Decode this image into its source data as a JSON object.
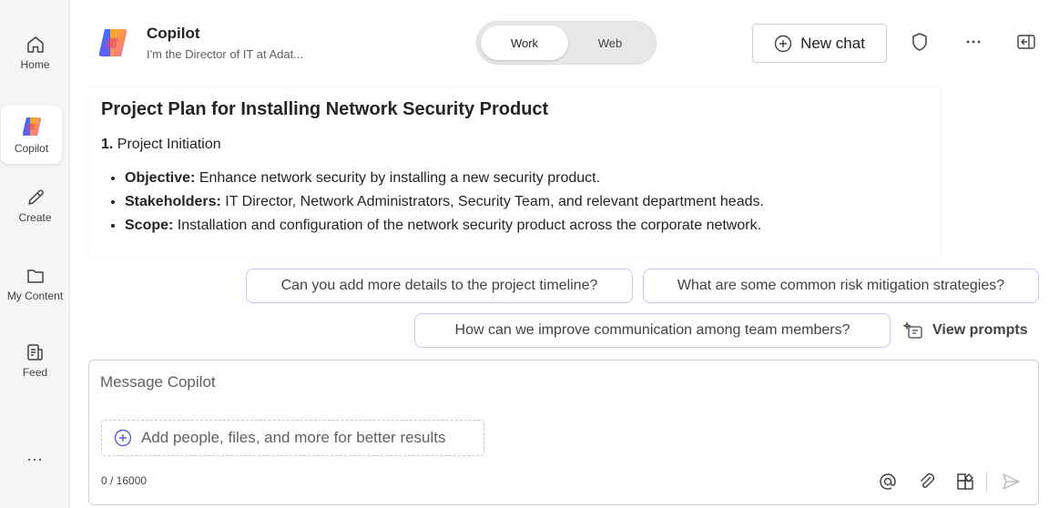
{
  "rail": {
    "items": [
      {
        "label": "Home",
        "icon": "home-icon"
      },
      {
        "label": "Copilot",
        "icon": "copilot-logo-icon"
      },
      {
        "label": "Create",
        "icon": "pen-icon"
      },
      {
        "label": "My Content",
        "icon": "folder-icon"
      },
      {
        "label": "Feed",
        "icon": "feed-icon"
      }
    ],
    "more_label": "..."
  },
  "header": {
    "title": "Copilot",
    "subtitle": "I'm the Director of IT at Adat...",
    "toggle": {
      "options": [
        "Work",
        "Web"
      ],
      "selected": "Work"
    },
    "new_chat_label": "New chat",
    "icons": [
      "shield-icon",
      "more-icon",
      "sidebar-toggle-icon"
    ]
  },
  "content": {
    "title": "Project Plan for Installing Network Security Product",
    "section_number": "1.",
    "section_title": "Project Initiation",
    "bullets": [
      {
        "term": "Objective:",
        "text": "Enhance network security by installing a new security product."
      },
      {
        "term": "Stakeholders:",
        "text": "IT Director, Network Administrators, Security Team, and relevant department heads."
      },
      {
        "term": "Scope:",
        "text": "Installation and configuration of the network security product across the corporate network."
      }
    ]
  },
  "suggestions": [
    "Can you add more details to the project timeline?",
    "What are some common risk mitigation strategies?",
    "How can we improve communication among team members?"
  ],
  "view_prompts_label": "View prompts",
  "composer": {
    "placeholder": "Message Copilot",
    "add_people_label": "Add people, files, and more for better results",
    "counter": "0 / 16000",
    "icons": [
      "mention-icon",
      "attach-icon",
      "apps-icon",
      "send-icon"
    ]
  },
  "colors": {
    "rail_bg": "#f5f5f5",
    "chip_border": "#c9c7ef",
    "text": "#242424"
  }
}
